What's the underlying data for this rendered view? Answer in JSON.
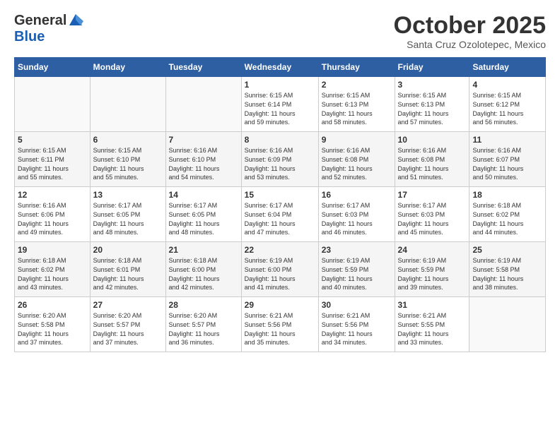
{
  "header": {
    "logo_general": "General",
    "logo_blue": "Blue",
    "month_title": "October 2025",
    "location": "Santa Cruz Ozolotepec, Mexico"
  },
  "weekdays": [
    "Sunday",
    "Monday",
    "Tuesday",
    "Wednesday",
    "Thursday",
    "Friday",
    "Saturday"
  ],
  "weeks": [
    [
      {
        "day": "",
        "info": ""
      },
      {
        "day": "",
        "info": ""
      },
      {
        "day": "",
        "info": ""
      },
      {
        "day": "1",
        "info": "Sunrise: 6:15 AM\nSunset: 6:14 PM\nDaylight: 11 hours\nand 59 minutes."
      },
      {
        "day": "2",
        "info": "Sunrise: 6:15 AM\nSunset: 6:13 PM\nDaylight: 11 hours\nand 58 minutes."
      },
      {
        "day": "3",
        "info": "Sunrise: 6:15 AM\nSunset: 6:13 PM\nDaylight: 11 hours\nand 57 minutes."
      },
      {
        "day": "4",
        "info": "Sunrise: 6:15 AM\nSunset: 6:12 PM\nDaylight: 11 hours\nand 56 minutes."
      }
    ],
    [
      {
        "day": "5",
        "info": "Sunrise: 6:15 AM\nSunset: 6:11 PM\nDaylight: 11 hours\nand 55 minutes."
      },
      {
        "day": "6",
        "info": "Sunrise: 6:15 AM\nSunset: 6:10 PM\nDaylight: 11 hours\nand 55 minutes."
      },
      {
        "day": "7",
        "info": "Sunrise: 6:16 AM\nSunset: 6:10 PM\nDaylight: 11 hours\nand 54 minutes."
      },
      {
        "day": "8",
        "info": "Sunrise: 6:16 AM\nSunset: 6:09 PM\nDaylight: 11 hours\nand 53 minutes."
      },
      {
        "day": "9",
        "info": "Sunrise: 6:16 AM\nSunset: 6:08 PM\nDaylight: 11 hours\nand 52 minutes."
      },
      {
        "day": "10",
        "info": "Sunrise: 6:16 AM\nSunset: 6:08 PM\nDaylight: 11 hours\nand 51 minutes."
      },
      {
        "day": "11",
        "info": "Sunrise: 6:16 AM\nSunset: 6:07 PM\nDaylight: 11 hours\nand 50 minutes."
      }
    ],
    [
      {
        "day": "12",
        "info": "Sunrise: 6:16 AM\nSunset: 6:06 PM\nDaylight: 11 hours\nand 49 minutes."
      },
      {
        "day": "13",
        "info": "Sunrise: 6:17 AM\nSunset: 6:05 PM\nDaylight: 11 hours\nand 48 minutes."
      },
      {
        "day": "14",
        "info": "Sunrise: 6:17 AM\nSunset: 6:05 PM\nDaylight: 11 hours\nand 48 minutes."
      },
      {
        "day": "15",
        "info": "Sunrise: 6:17 AM\nSunset: 6:04 PM\nDaylight: 11 hours\nand 47 minutes."
      },
      {
        "day": "16",
        "info": "Sunrise: 6:17 AM\nSunset: 6:03 PM\nDaylight: 11 hours\nand 46 minutes."
      },
      {
        "day": "17",
        "info": "Sunrise: 6:17 AM\nSunset: 6:03 PM\nDaylight: 11 hours\nand 45 minutes."
      },
      {
        "day": "18",
        "info": "Sunrise: 6:18 AM\nSunset: 6:02 PM\nDaylight: 11 hours\nand 44 minutes."
      }
    ],
    [
      {
        "day": "19",
        "info": "Sunrise: 6:18 AM\nSunset: 6:02 PM\nDaylight: 11 hours\nand 43 minutes."
      },
      {
        "day": "20",
        "info": "Sunrise: 6:18 AM\nSunset: 6:01 PM\nDaylight: 11 hours\nand 42 minutes."
      },
      {
        "day": "21",
        "info": "Sunrise: 6:18 AM\nSunset: 6:00 PM\nDaylight: 11 hours\nand 42 minutes."
      },
      {
        "day": "22",
        "info": "Sunrise: 6:19 AM\nSunset: 6:00 PM\nDaylight: 11 hours\nand 41 minutes."
      },
      {
        "day": "23",
        "info": "Sunrise: 6:19 AM\nSunset: 5:59 PM\nDaylight: 11 hours\nand 40 minutes."
      },
      {
        "day": "24",
        "info": "Sunrise: 6:19 AM\nSunset: 5:59 PM\nDaylight: 11 hours\nand 39 minutes."
      },
      {
        "day": "25",
        "info": "Sunrise: 6:19 AM\nSunset: 5:58 PM\nDaylight: 11 hours\nand 38 minutes."
      }
    ],
    [
      {
        "day": "26",
        "info": "Sunrise: 6:20 AM\nSunset: 5:58 PM\nDaylight: 11 hours\nand 37 minutes."
      },
      {
        "day": "27",
        "info": "Sunrise: 6:20 AM\nSunset: 5:57 PM\nDaylight: 11 hours\nand 37 minutes."
      },
      {
        "day": "28",
        "info": "Sunrise: 6:20 AM\nSunset: 5:57 PM\nDaylight: 11 hours\nand 36 minutes."
      },
      {
        "day": "29",
        "info": "Sunrise: 6:21 AM\nSunset: 5:56 PM\nDaylight: 11 hours\nand 35 minutes."
      },
      {
        "day": "30",
        "info": "Sunrise: 6:21 AM\nSunset: 5:56 PM\nDaylight: 11 hours\nand 34 minutes."
      },
      {
        "day": "31",
        "info": "Sunrise: 6:21 AM\nSunset: 5:55 PM\nDaylight: 11 hours\nand 33 minutes."
      },
      {
        "day": "",
        "info": ""
      }
    ]
  ]
}
